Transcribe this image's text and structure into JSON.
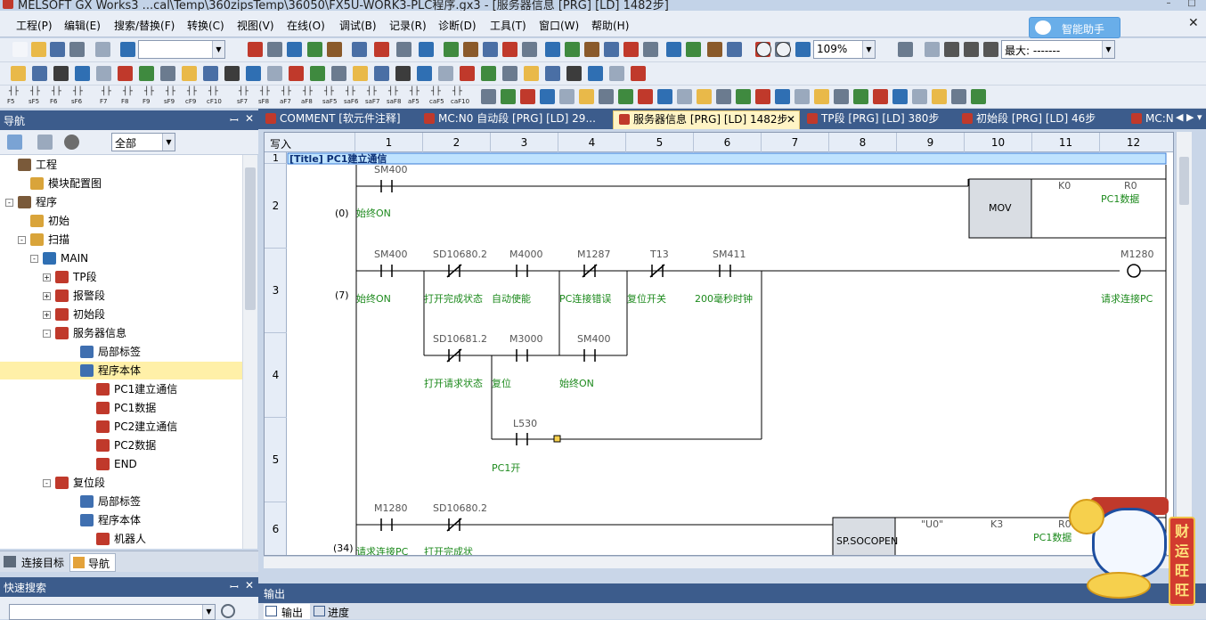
{
  "window": {
    "title": "MELSOFT GX Works3 ...cal\\Temp\\360zipsTemp\\36050\\FX5U-WORK3-PLC程序.gx3 - [服务器信息 [PRG] [LD] 1482步]"
  },
  "menu": [
    "工程(P)",
    "编辑(E)",
    "搜索/替换(F)",
    "转换(C)",
    "视图(V)",
    "在线(O)",
    "调试(B)",
    "记录(R)",
    "诊断(D)",
    "工具(T)",
    "窗口(W)",
    "帮助(H)"
  ],
  "helper": {
    "label": "智能助手"
  },
  "toolbar": {
    "zoom": "109%",
    "max_label": "最大: -------",
    "instr_row": [
      "F5",
      "sF5",
      "F6",
      "sF6",
      "F7",
      "F8",
      "F9",
      "sF9",
      "cF9",
      "cF10",
      "sF7",
      "sF8",
      "aF7",
      "aF8",
      "saF5",
      "saF6",
      "saF7",
      "saF8",
      "aF5",
      "caF5",
      "caF10"
    ]
  },
  "nav": {
    "title": "导航",
    "filter": "全部",
    "tree": [
      {
        "label": "工程",
        "level": 0,
        "exp": ""
      },
      {
        "label": "模块配置图",
        "level": 1,
        "exp": ""
      },
      {
        "label": "程序",
        "level": 0,
        "exp": "-"
      },
      {
        "label": "初始",
        "level": 1,
        "exp": ""
      },
      {
        "label": "扫描",
        "level": 1,
        "exp": "-"
      },
      {
        "label": "MAIN",
        "level": 2,
        "exp": "-"
      },
      {
        "label": "TP段",
        "level": 3,
        "exp": "+"
      },
      {
        "label": "报警段",
        "level": 3,
        "exp": "+"
      },
      {
        "label": "初始段",
        "level": 3,
        "exp": "+"
      },
      {
        "label": "服务器信息",
        "level": 3,
        "exp": "-"
      },
      {
        "label": "局部标签",
        "level": 4,
        "exp": ""
      },
      {
        "label": "程序本体",
        "level": 4,
        "exp": "",
        "selected": true
      },
      {
        "label": "PC1建立通信",
        "level": 5,
        "exp": ""
      },
      {
        "label": "PC1数据",
        "level": 5,
        "exp": ""
      },
      {
        "label": "PC2建立通信",
        "level": 5,
        "exp": ""
      },
      {
        "label": "PC2数据",
        "level": 5,
        "exp": ""
      },
      {
        "label": "END",
        "level": 5,
        "exp": ""
      },
      {
        "label": "复位段",
        "level": 3,
        "exp": "-"
      },
      {
        "label": "局部标签",
        "level": 4,
        "exp": ""
      },
      {
        "label": "程序本体",
        "level": 4,
        "exp": ""
      },
      {
        "label": "机器人",
        "level": 5,
        "exp": ""
      }
    ],
    "tabs": [
      "连接目标",
      "导航"
    ]
  },
  "quicksearch": {
    "title": "快速搜索"
  },
  "tabs": [
    {
      "label": "COMMENT [软元件注释]"
    },
    {
      "label": "MC:N0 自动段 [PRG] [LD] 29..."
    },
    {
      "label": "服务器信息 [PRG] [LD] 1482步",
      "active": true
    },
    {
      "label": "TP段 [PRG] [LD] 380步"
    },
    {
      "label": "初始段 [PRG] [LD] 46步"
    },
    {
      "label": "MC:N"
    }
  ],
  "editor": {
    "mode": "写入",
    "columns": [
      "1",
      "2",
      "3",
      "4",
      "5",
      "6",
      "7",
      "8",
      "9",
      "10",
      "11",
      "12"
    ],
    "rows": [
      "1",
      "2",
      "3",
      "4",
      "5",
      "6"
    ],
    "title_row": "[Title] PC1建立通信",
    "step_numbers": [
      "(0)",
      "(7)",
      "(34)"
    ],
    "devices": {
      "sm400_a": "SM400",
      "mov": "MOV",
      "k0": "K0",
      "r0_a": "R0",
      "pc1data_a": "PC1数据",
      "always_on_a": "始终ON",
      "sm400_b": "SM400",
      "sd10680_a": "SD10680.2",
      "m4000": "M4000",
      "m1287": "M1287",
      "t13": "T13",
      "sm411": "SM411",
      "m1280_coil": "M1280",
      "always_on_b": "始终ON",
      "open_done_a": "打开完成状态",
      "auto_enable": "自动使能",
      "pc_conn_err": "PC连接错误",
      "reset_sw": "复位开关",
      "ms200": "200毫秒时钟",
      "req_conn_a": "请求连接PC",
      "sd10681": "SD10681.2",
      "m3000": "M3000",
      "sm400_c": "SM400",
      "open_req": "打开请求状态",
      "reset": "复位",
      "always_on_c": "始终ON",
      "l530": "L530",
      "pc1_open": "PC1开",
      "m1280_b": "M1280",
      "sd10680_b": "SD10680.2",
      "req_conn_b": "请求连接PC",
      "open_done_b": "打开完成状",
      "socopen": "SP.SOCOPEN",
      "u0": "\"U0\"",
      "k3": "K3",
      "r0_b": "R0",
      "pc1data_b": "PC1数据"
    }
  },
  "output": {
    "title": "输出",
    "tabs": [
      "输出",
      "进度"
    ]
  },
  "mascot": {
    "banner": "财运旺旺"
  }
}
